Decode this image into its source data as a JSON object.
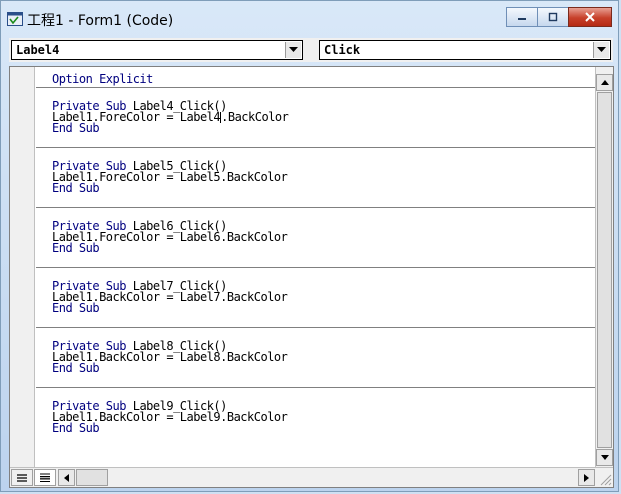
{
  "window": {
    "title": "工程1 - Form1 (Code)"
  },
  "icons": {
    "app": "vb-project-icon",
    "minimize": "minimize-icon",
    "maximize": "maximize-icon",
    "close": "close-icon"
  },
  "toolbar": {
    "object_combo": {
      "value": "Label4"
    },
    "procedure_combo": {
      "value": "Click"
    }
  },
  "code": {
    "header": "Option Explicit",
    "procedures": [
      {
        "sub_kw": "Private Sub",
        "sub_name": "Label4_Click()",
        "body": "Label1.ForeColor = Label4",
        "body_after_caret": ".BackColor",
        "end": "End Sub",
        "has_caret": true
      },
      {
        "sub_kw": "Private Sub",
        "sub_name": "Label5_Click()",
        "body": "Label1.ForeColor = Label5.BackColor",
        "end": "End Sub"
      },
      {
        "sub_kw": "Private Sub",
        "sub_name": "Label6_Click()",
        "body": "Label1.ForeColor = Label6.BackColor",
        "end": "End Sub"
      },
      {
        "sub_kw": "Private Sub",
        "sub_name": "Label7_Click()",
        "body": "Label1.BackColor = Label7.BackColor",
        "end": "End Sub"
      },
      {
        "sub_kw": "Private Sub",
        "sub_name": "Label8_Click()",
        "body": "Label1.BackColor = Label8.BackColor",
        "end": "End Sub"
      },
      {
        "sub_kw": "Private Sub",
        "sub_name": "Label9_Click()",
        "body": "Label1.BackColor = Label9.BackColor",
        "end": "End Sub"
      }
    ]
  },
  "colors": {
    "keyword": "#00007f",
    "text": "#000000",
    "close_button": "#c7402a"
  }
}
